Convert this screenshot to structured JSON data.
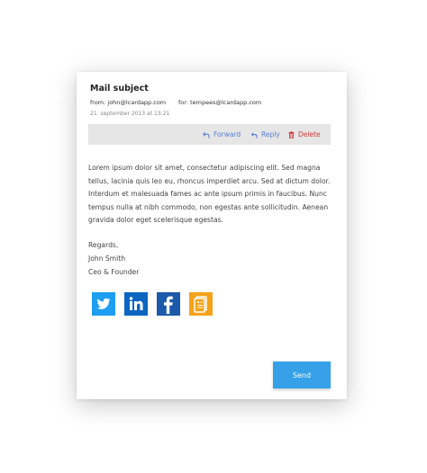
{
  "mail": {
    "subject": "Mail subject",
    "from": "from: john@lcardapp.com",
    "for": "for: tempees@lcardapp.com",
    "date": "21. september 2013 at 13:21"
  },
  "actions": {
    "forward": "Forward",
    "reply": "Reply",
    "delete": "Delete"
  },
  "body": {
    "text": "Lorem ipsum dolor sit amet, consectetur adipiscing elit. Sed magna tellus, lacinia quis leo eu, rhoncus imperdiet arcu. Sed at dictum dolor. Interdum et malesuada fames ac ante ipsum primis in faucibus. Nunc tempus nulla at nibh commodo, non egestas ante sollicitudin. Aenean gravida dolor eget scelerisque egestas."
  },
  "signature": {
    "regards": "Regards,",
    "name": "John Smith",
    "title": "Ceo & Founder"
  },
  "social_icons": [
    "twitter-icon",
    "linkedin-icon",
    "facebook-icon",
    "icard-icon"
  ],
  "colors": {
    "accent": "#36a1e8",
    "action_link": "#5b7fd6",
    "delete": "#d23b3b",
    "twitter": "#1d9ef0",
    "linkedin": "#0b66c2",
    "facebook": "#1b5aab",
    "icard": "#f5a31a"
  },
  "send_label": "Send"
}
